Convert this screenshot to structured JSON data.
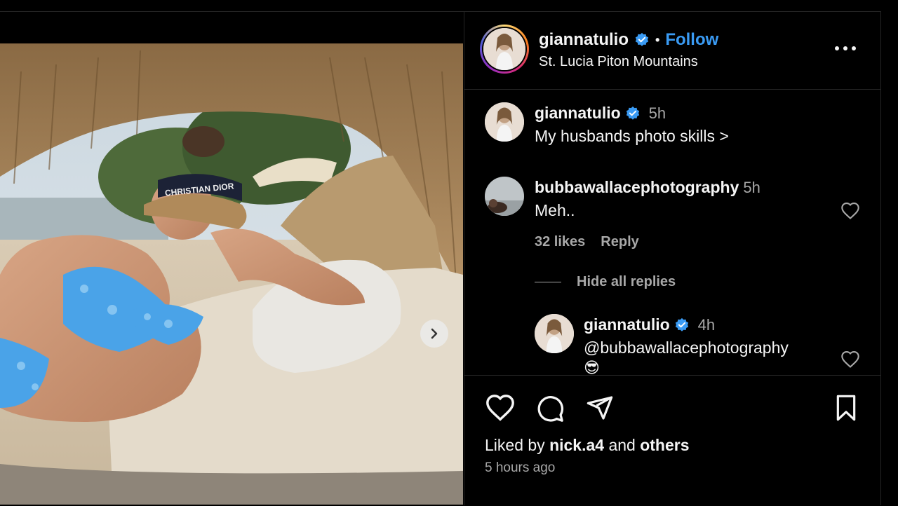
{
  "post": {
    "username": "giannatulio",
    "separator": "•",
    "follow_label": "Follow",
    "location": "St. Lucia Piton Mountains",
    "visor_text": "CHRISTIAN DIOR"
  },
  "comments": [
    {
      "username": "giannatulio",
      "time": "5h",
      "text": "My husbands photo skills >"
    },
    {
      "username": "bubbawallacephotography",
      "time": "5h",
      "text": "Meh..",
      "likes": "32 likes",
      "reply_label": "Reply"
    }
  ],
  "hide_replies_label": "Hide all replies",
  "reply": {
    "username": "giannatulio",
    "time": "4h",
    "text": "@bubbawallacephotography",
    "emoji": "😎"
  },
  "likes": {
    "prefix": "Liked by",
    "user": "nick.a4",
    "and": "and",
    "others": "others"
  },
  "timestamp": "5 hours ago",
  "colors": {
    "accent": "#3a9bf4",
    "background": "#000000",
    "secondary_text": "#a8a8a8",
    "divider": "#262626"
  },
  "icons": [
    "verified-badge-icon",
    "more-options-icon",
    "heart-icon",
    "comment-icon",
    "share-icon",
    "bookmark-icon",
    "chevron-right-icon"
  ]
}
